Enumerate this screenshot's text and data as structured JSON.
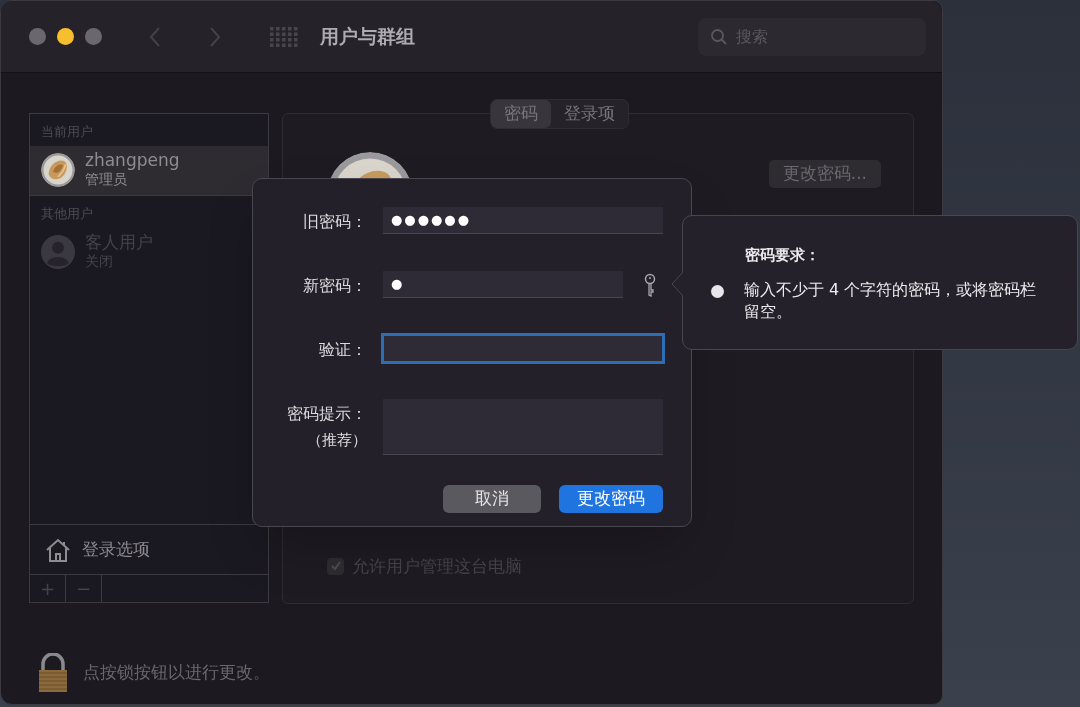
{
  "window": {
    "title": "用户与群组",
    "search": {
      "placeholder": "搜索"
    }
  },
  "tabs": [
    {
      "label": "密码",
      "selected": true
    },
    {
      "label": "登录项",
      "selected": false
    }
  ],
  "sidebar": {
    "sections": [
      {
        "heading": "当前用户",
        "users": [
          {
            "name": "zhangpeng",
            "role": "管理员",
            "kind": "picture",
            "selected": true,
            "disabled": false
          }
        ]
      },
      {
        "heading": "其他用户",
        "users": [
          {
            "name": "客人用户",
            "role": "关闭",
            "kind": "silhouette",
            "selected": false,
            "disabled": true
          }
        ]
      }
    ],
    "login_options": "登录选项",
    "buttons": [
      "+",
      "−"
    ]
  },
  "panel": {
    "change_password_button": "更改密码...",
    "checkbox": {
      "label": "允许用户管理这台电脑",
      "checked": true
    }
  },
  "lock": {
    "text": "点按锁按钮以进行更改。"
  },
  "dialog": {
    "fields": [
      {
        "label": "旧密码：",
        "kind": "password",
        "value": "●●●●●●",
        "focused": false
      },
      {
        "label": "新密码：",
        "kind": "password",
        "value": "●",
        "focused": false,
        "key_button": true
      },
      {
        "label": "验证：",
        "kind": "password",
        "focused": true
      },
      {
        "label": "密码提示：",
        "sublabel": "（推荐）",
        "kind": "textarea",
        "focused": false
      }
    ],
    "buttons": [
      {
        "label": "取消",
        "primary": false
      },
      {
        "label": "更改密码",
        "primary": true
      }
    ]
  },
  "popover": {
    "title": "密码要求：",
    "items": [
      "输入不少于 4 个字符的密码，或将密码栏留空。"
    ]
  }
}
